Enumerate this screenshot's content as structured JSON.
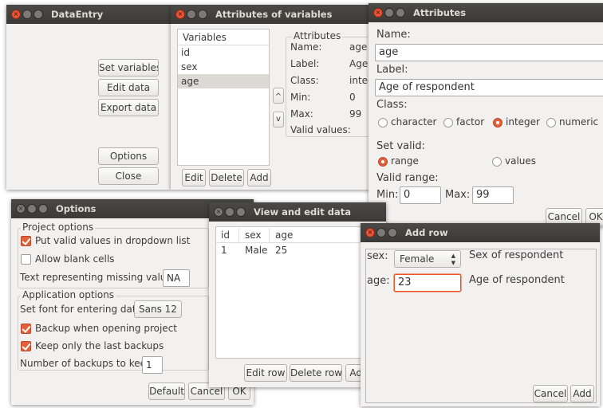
{
  "windows": {
    "dataentry": {
      "title": "DataEntry",
      "set_variables": "Set variables",
      "edit_data": "Edit data",
      "export_data": "Export data",
      "options": "Options",
      "close": "Close"
    },
    "attributes_of_variables": {
      "title": "Attributes of variables",
      "list_header": "Variables",
      "variables": [
        "id",
        "sex",
        "age"
      ],
      "selected": "age",
      "attributes_group": "Attributes",
      "name_label": "Name:",
      "name_value": "age",
      "label_label": "Label:",
      "label_value": "Age",
      "class_label": "Class:",
      "class_value": "integ",
      "min_label": "Min:",
      "min_value": "0",
      "max_label": "Max:",
      "max_value": "99",
      "valid_values_label": "Valid values:",
      "up_arrow": "^",
      "down_arrow": "v",
      "edit": "Edit",
      "delete": "Delete",
      "add": "Add"
    },
    "attributes": {
      "title": "Attributes",
      "name_label": "Name:",
      "name_value": "age",
      "label_label": "Label:",
      "label_value": "Age of respondent",
      "class_label": "Class:",
      "class_options": [
        "character",
        "factor",
        "integer",
        "numeric"
      ],
      "class_selected": "integer",
      "set_valid_label": "Set valid:",
      "valid_options": [
        "range",
        "values"
      ],
      "valid_selected": "range",
      "valid_range_label": "Valid range:",
      "min_label": "Min:",
      "min_value": "0",
      "max_label": "Max:",
      "max_value": "99",
      "cancel": "Cancel",
      "ok": "OK"
    },
    "options": {
      "title": "Options",
      "project_group": "Project options",
      "put_valid_values": "Put valid values in dropdown list",
      "put_valid_values_checked": true,
      "allow_blank": "Allow blank cells",
      "allow_blank_checked": false,
      "missing_label": "Text representing missing values:",
      "missing_value": "NA",
      "app_group": "Application options",
      "font_label": "Set font for entering data:",
      "font_value": "Sans  12",
      "backup_opening": "Backup when opening project",
      "backup_opening_checked": true,
      "keep_last": "Keep only the last backups",
      "keep_last_checked": true,
      "num_backups_label": "Number of backups to keep:",
      "num_backups_value": "1",
      "default": "Default",
      "cancel": "Cancel",
      "ok": "OK"
    },
    "view_edit": {
      "title": "View and edit data",
      "columns": [
        "id",
        "sex",
        "age"
      ],
      "rows": [
        [
          "1",
          "Male",
          "25"
        ]
      ],
      "edit_row": "Edit row",
      "delete_row": "Delete row",
      "add": "Add"
    },
    "add_row": {
      "title": "Add row",
      "sex_label": "sex:",
      "sex_value": "Female",
      "sex_desc": "Sex of respondent",
      "age_label": "age:",
      "age_value": "23",
      "age_desc": "Age of respondent",
      "cancel": "Cancel",
      "add": "Add"
    }
  },
  "colors": {
    "accent": "#e95420",
    "titlebar": "#3c3b37",
    "window_bg": "#f2f1f0",
    "selection": "#dcdad5"
  },
  "icons": {
    "close": "close-icon",
    "minimize": "minimize-icon",
    "maximize": "maximize-icon",
    "spin": "spin-arrows-icon"
  }
}
